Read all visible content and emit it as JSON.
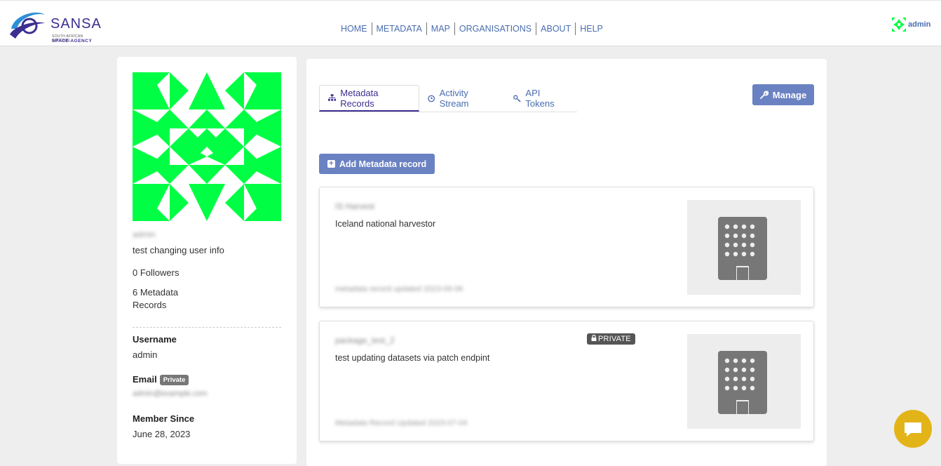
{
  "header": {
    "logo_text": "SANSA",
    "logo_sub1": "SOUTH AFRICAN NATIONAL",
    "logo_sub2": "SPACE AGENCY",
    "nav": [
      "HOME",
      "METADATA",
      "MAP",
      "ORGANISATIONS",
      "ABOUT",
      "HELP"
    ],
    "user_label": "admin"
  },
  "profile": {
    "display_name": "admin",
    "about": "test changing user info",
    "followers": "0 Followers",
    "metadata_records": "6 Metadata Records",
    "username_label": "Username",
    "username_value": "admin",
    "email_label": "Email",
    "email_badge": "Private",
    "email_value": "admin@example.com",
    "member_since_label": "Member Since",
    "member_since_value": "June 28, 2023"
  },
  "tabs": [
    {
      "label": "Metadata Records",
      "icon": "sitemap-icon",
      "active": true
    },
    {
      "label": "Activity Stream",
      "icon": "clock-icon",
      "active": false
    },
    {
      "label": "API Tokens",
      "icon": "key-icon",
      "active": false
    }
  ],
  "actions": {
    "manage_label": "Manage",
    "add_label": "Add Metadata record"
  },
  "records": [
    {
      "title": "IS Harvest",
      "description": "Iceland national harvestor",
      "meta": "metadata record updated 2023-09-06",
      "private": false
    },
    {
      "title": "package_test_2",
      "description": "test updating datasets via patch endpint",
      "meta": "Metadata Record Updated 2023-07-04",
      "private": true,
      "private_label": "PRIVATE"
    }
  ],
  "colors": {
    "brand": "#3b2f91",
    "link": "#4a6db0",
    "button": "#6b82c2",
    "avatar_green": "#00ff44",
    "chat": "#e3b418"
  }
}
